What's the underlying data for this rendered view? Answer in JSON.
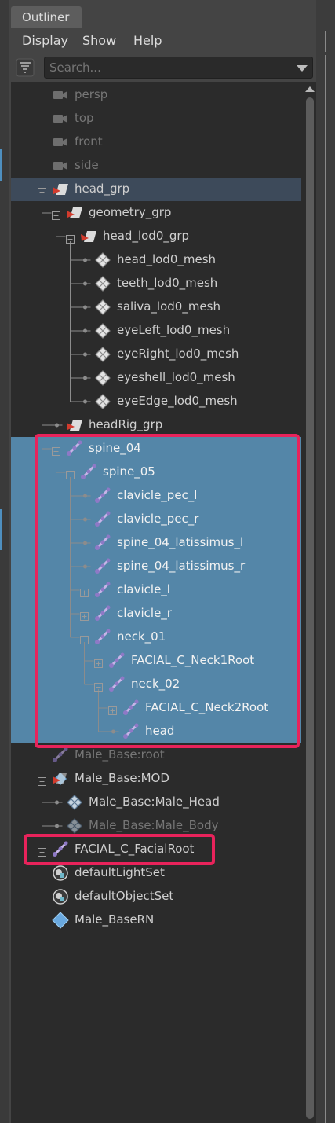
{
  "tab": {
    "title": "Outliner"
  },
  "menu": [
    "Display",
    "Show",
    "Help"
  ],
  "search": {
    "placeholder": "Search..."
  },
  "colors": {
    "selection": "#5486a8",
    "row_highlight": "#3d4a5a",
    "annotation": "#e8235b",
    "text": "#cfcfcf",
    "dim_text": "#767676"
  },
  "tree": [
    {
      "label": "persp",
      "icon": "camera",
      "depth": 0,
      "dim": true,
      "toggle": "none"
    },
    {
      "label": "top",
      "icon": "camera",
      "depth": 0,
      "dim": true,
      "toggle": "none"
    },
    {
      "label": "front",
      "icon": "camera",
      "depth": 0,
      "dim": true,
      "toggle": "none"
    },
    {
      "label": "side",
      "icon": "camera",
      "depth": 0,
      "dim": true,
      "toggle": "none"
    },
    {
      "label": "head_grp",
      "icon": "group",
      "depth": 0,
      "toggle": "minus",
      "hover": true
    },
    {
      "label": "geometry_grp",
      "icon": "group",
      "depth": 1,
      "toggle": "minus"
    },
    {
      "label": "head_lod0_grp",
      "icon": "group",
      "depth": 2,
      "toggle": "minus"
    },
    {
      "label": "head_lod0_mesh",
      "icon": "mesh",
      "depth": 3,
      "toggle": "none"
    },
    {
      "label": "teeth_lod0_mesh",
      "icon": "mesh",
      "depth": 3,
      "toggle": "none"
    },
    {
      "label": "saliva_lod0_mesh",
      "icon": "mesh",
      "depth": 3,
      "toggle": "none"
    },
    {
      "label": "eyeLeft_lod0_mesh",
      "icon": "mesh",
      "depth": 3,
      "toggle": "none"
    },
    {
      "label": "eyeRight_lod0_mesh",
      "icon": "mesh",
      "depth": 3,
      "toggle": "none"
    },
    {
      "label": "eyeshell_lod0_mesh",
      "icon": "mesh",
      "depth": 3,
      "toggle": "none"
    },
    {
      "label": "eyeEdge_lod0_mesh",
      "icon": "mesh",
      "depth": 3,
      "toggle": "none"
    },
    {
      "label": "headRig_grp",
      "icon": "group",
      "depth": 1,
      "toggle": "none"
    },
    {
      "label": "spine_04",
      "icon": "joint",
      "depth": 1,
      "toggle": "minus",
      "selected": true
    },
    {
      "label": "spine_05",
      "icon": "joint",
      "depth": 2,
      "toggle": "minus",
      "selected": true
    },
    {
      "label": "clavicle_pec_l",
      "icon": "joint",
      "depth": 3,
      "toggle": "none",
      "selected": true
    },
    {
      "label": "clavicle_pec_r",
      "icon": "joint",
      "depth": 3,
      "toggle": "none",
      "selected": true
    },
    {
      "label": "spine_04_latissimus_l",
      "icon": "joint",
      "depth": 3,
      "toggle": "none",
      "selected": true
    },
    {
      "label": "spine_04_latissimus_r",
      "icon": "joint",
      "depth": 3,
      "toggle": "none",
      "selected": true
    },
    {
      "label": "clavicle_l",
      "icon": "joint",
      "depth": 3,
      "toggle": "plus",
      "selected": true
    },
    {
      "label": "clavicle_r",
      "icon": "joint",
      "depth": 3,
      "toggle": "plus",
      "selected": true
    },
    {
      "label": "neck_01",
      "icon": "joint",
      "depth": 3,
      "toggle": "minus",
      "selected": true
    },
    {
      "label": "FACIAL_C_Neck1Root",
      "icon": "joint",
      "depth": 4,
      "toggle": "plus",
      "selected": true
    },
    {
      "label": "neck_02",
      "icon": "joint",
      "depth": 4,
      "toggle": "minus",
      "selected": true
    },
    {
      "label": "FACIAL_C_Neck2Root",
      "icon": "joint",
      "depth": 5,
      "toggle": "plus",
      "selected": true
    },
    {
      "label": "head",
      "icon": "joint",
      "depth": 5,
      "toggle": "none",
      "selected": true
    },
    {
      "label": "Male_Base:root",
      "icon": "joint",
      "depth": 0,
      "dim": true,
      "toggle": "plus"
    },
    {
      "label": "Male_Base:MOD",
      "icon": "group-mesh",
      "depth": 0,
      "toggle": "minus"
    },
    {
      "label": "Male_Base:Male_Head",
      "icon": "mesh-blue",
      "depth": 1,
      "toggle": "none"
    },
    {
      "label": "Male_Base:Male_Body",
      "icon": "mesh-blue",
      "depth": 1,
      "dim": true,
      "toggle": "none"
    },
    {
      "label": "FACIAL_C_FacialRoot",
      "icon": "joint",
      "depth": 0,
      "toggle": "plus"
    },
    {
      "label": "defaultLightSet",
      "icon": "set",
      "depth": 0,
      "toggle": "none"
    },
    {
      "label": "defaultObjectSet",
      "icon": "set",
      "depth": 0,
      "toggle": "none"
    },
    {
      "label": "Male_BaseRN",
      "icon": "reference",
      "depth": 0,
      "toggle": "plus"
    }
  ]
}
